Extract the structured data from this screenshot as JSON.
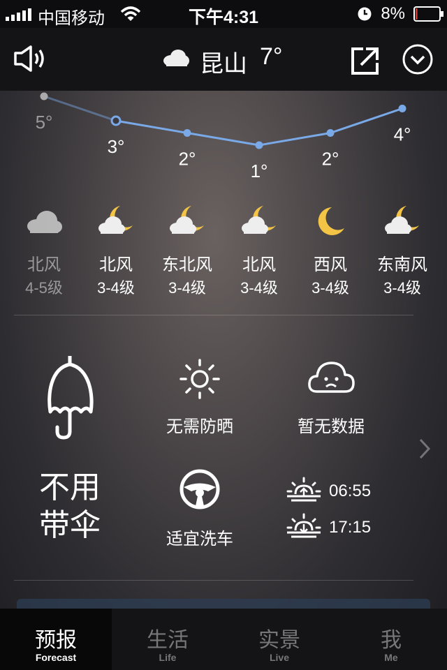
{
  "status_bar": {
    "carrier": "中国移动",
    "time": "下午4:31",
    "battery": "8%",
    "battery_level": 0.08,
    "icons": [
      "signal-icon",
      "wifi-icon",
      "alarm-clock-icon",
      "battery-icon"
    ]
  },
  "header": {
    "city": "昆山",
    "temp": "7°",
    "icons": [
      "speaker-icon",
      "cloud-icon",
      "share-icon",
      "chevron-down-icon"
    ]
  },
  "forecast": [
    {
      "temp": "5°",
      "wind_dir": "北风",
      "wind_level": "4-5级",
      "icon": "cloud-icon",
      "dimmed": true
    },
    {
      "temp": "3°",
      "wind_dir": "北风",
      "wind_level": "3-4级",
      "icon": "cloudy-night-icon",
      "dimmed": false
    },
    {
      "temp": "2°",
      "wind_dir": "东北风",
      "wind_level": "3-4级",
      "icon": "cloudy-night-icon",
      "dimmed": false
    },
    {
      "temp": "1°",
      "wind_dir": "北风",
      "wind_level": "3-4级",
      "icon": "cloudy-night-icon",
      "dimmed": false
    },
    {
      "temp": "2°",
      "wind_dir": "西风",
      "wind_level": "3-4级",
      "icon": "moon-icon",
      "dimmed": false
    },
    {
      "temp": "4°",
      "wind_dir": "东南风",
      "wind_level": "3-4级",
      "icon": "cloudy-night-icon",
      "dimmed": false
    }
  ],
  "life": {
    "umbrella_line1": "不用",
    "umbrella_line2": "带伞",
    "sunscreen": "无需防晒",
    "no_data": "暂无数据",
    "car_wash": "适宜洗车",
    "sunrise": "06:55",
    "sunset": "17:15"
  },
  "tabs": [
    {
      "cn": "预报",
      "en": "Forecast",
      "active": true
    },
    {
      "cn": "生活",
      "en": "Life",
      "active": false
    },
    {
      "cn": "实景",
      "en": "Live",
      "active": false
    },
    {
      "cn": "我",
      "en": "Me",
      "active": false
    }
  ],
  "colors": {
    "accent_line": "#7aa9e8",
    "moon": "#f3c446",
    "battery_low": "#d9342b"
  }
}
